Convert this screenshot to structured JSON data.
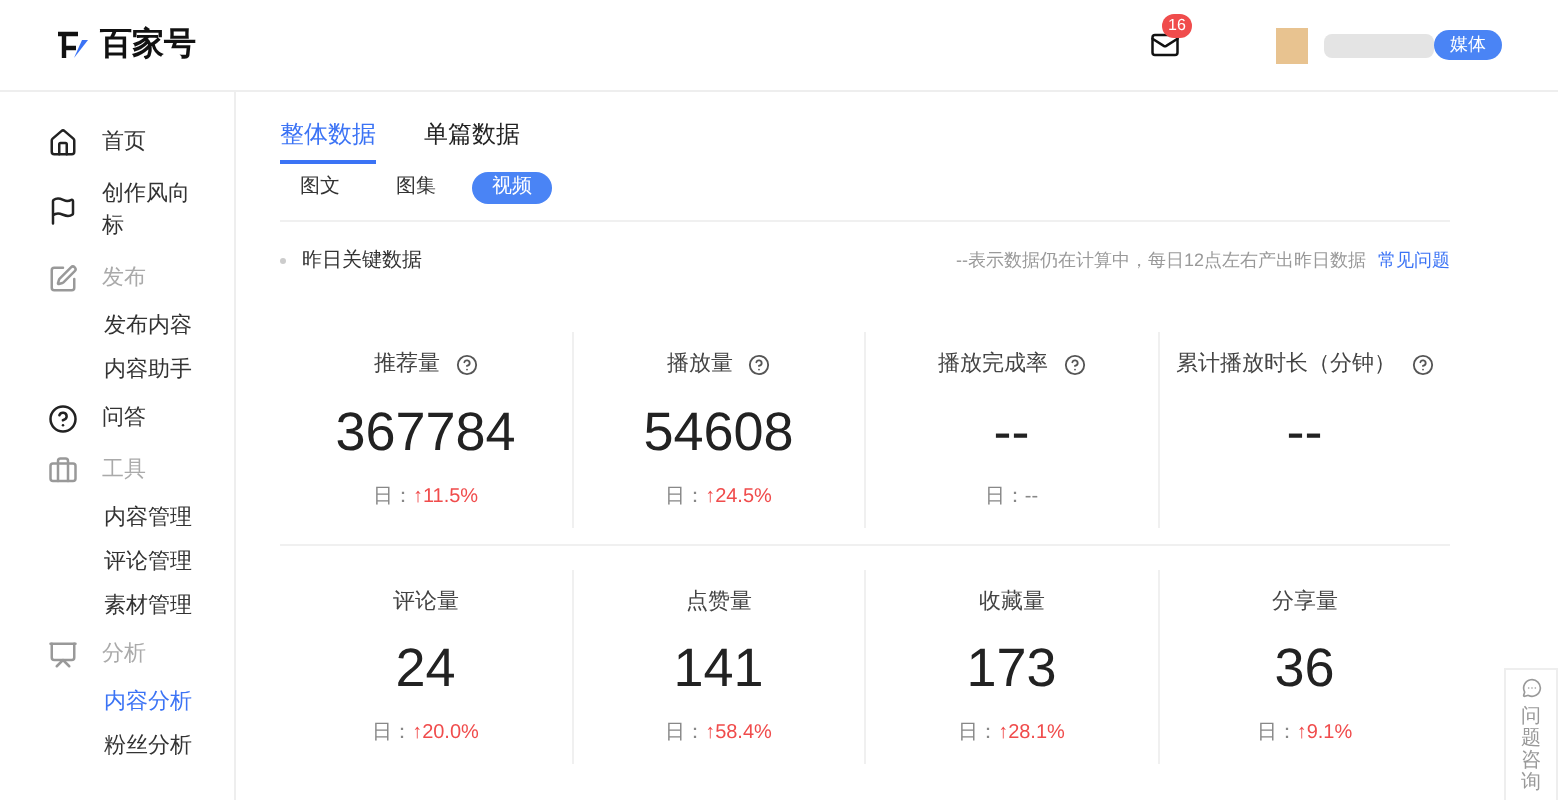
{
  "header": {
    "logo_text": "百家号",
    "mail_badge": "16",
    "account_tag": "媒体"
  },
  "sidebar": {
    "items": [
      {
        "label": "首页",
        "kind": "link",
        "selected": false
      },
      {
        "label": "创作风向标",
        "kind": "link",
        "selected": false
      },
      {
        "label": "发布",
        "kind": "group",
        "selected": false
      },
      {
        "label": "发布内容",
        "kind": "sub",
        "selected": false
      },
      {
        "label": "内容助手",
        "kind": "sub",
        "selected": false
      },
      {
        "label": "问答",
        "kind": "link",
        "selected": false
      },
      {
        "label": "工具",
        "kind": "group",
        "selected": false
      },
      {
        "label": "内容管理",
        "kind": "sub",
        "selected": false
      },
      {
        "label": "评论管理",
        "kind": "sub",
        "selected": false
      },
      {
        "label": "素材管理",
        "kind": "sub",
        "selected": false
      },
      {
        "label": "分析",
        "kind": "group",
        "selected": false
      },
      {
        "label": "内容分析",
        "kind": "sub",
        "selected": true
      },
      {
        "label": "粉丝分析",
        "kind": "sub",
        "selected": false
      }
    ]
  },
  "tabs": [
    {
      "label": "整体数据",
      "selected": true
    },
    {
      "label": "单篇数据",
      "selected": false
    }
  ],
  "filters": [
    {
      "label": "图文",
      "selected": false
    },
    {
      "label": "图集",
      "selected": false
    },
    {
      "label": "视频",
      "selected": true
    }
  ],
  "section": {
    "title": "昨日关键数据",
    "note": "--表示数据仍在计算中，每日12点左右产出昨日数据",
    "link": "常见问题"
  },
  "metric_rows": [
    [
      {
        "label": "推荐量",
        "help": true,
        "value": "367784",
        "day_label": "日：",
        "change": "↑11.5%",
        "kind": "up"
      },
      {
        "label": "播放量",
        "help": true,
        "value": "54608",
        "day_label": "日：",
        "change": "↑24.5%",
        "kind": "up"
      },
      {
        "label": "播放完成率",
        "help": true,
        "value": "--",
        "day_label": "日：",
        "change": "--",
        "kind": "flat"
      },
      {
        "label": "累计播放时长（分钟）",
        "help": true,
        "value": "--",
        "kind": "none"
      }
    ],
    [
      {
        "label": "评论量",
        "help": false,
        "value": "24",
        "day_label": "日：",
        "change": "↑20.0%",
        "kind": "up"
      },
      {
        "label": "点赞量",
        "help": false,
        "value": "141",
        "day_label": "日：",
        "change": "↑58.4%",
        "kind": "up"
      },
      {
        "label": "收藏量",
        "help": false,
        "value": "173",
        "day_label": "日：",
        "change": "↑28.1%",
        "kind": "up"
      },
      {
        "label": "分享量",
        "help": false,
        "value": "36",
        "day_label": "日：",
        "change": "↑9.1%",
        "kind": "up"
      }
    ]
  ],
  "help_float": {
    "label": "问题咨询"
  }
}
